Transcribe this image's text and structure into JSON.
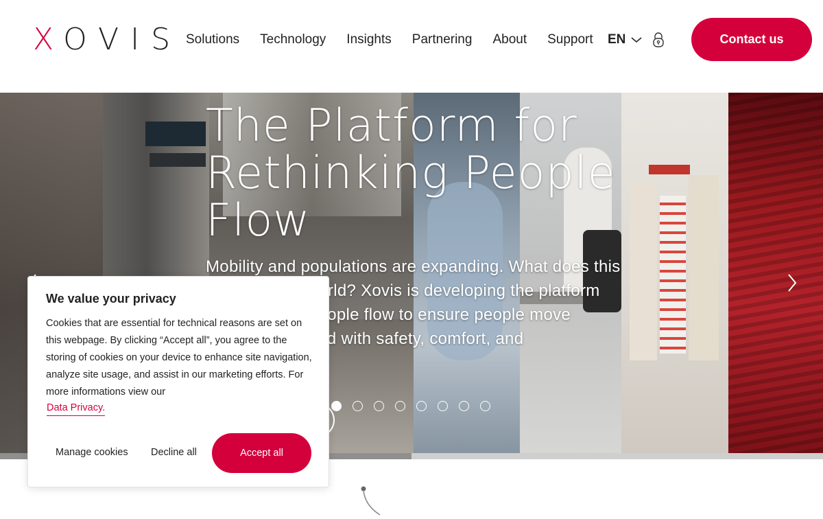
{
  "header": {
    "logo_x": "X",
    "logo_rest": "OVIS",
    "nav": [
      "Solutions",
      "Technology",
      "Insights",
      "Partnering",
      "About",
      "Support"
    ],
    "language": "EN",
    "contact_label": "Contact us"
  },
  "hero": {
    "title": "The Platform for Rethinking People Flow",
    "subtitle": "Mobility and populations are expanding. What does this mean for our world? Xovis is developing the platform for rethinking people flow to ensure people move through the world with safety, comfort, and",
    "slide_count": 8,
    "active_slide": 1,
    "progress_fraction": 0.5
  },
  "cookie": {
    "title": "We value your privacy",
    "text": "Cookies that are essential for technical reasons are set on this webpage. By clicking “Accept all”, you agree to the storing of cookies on your device to enhance site navigation, analyze site usage, and assist in our marketing efforts. For more informations view our",
    "link": "Data Privacy.",
    "manage": "Manage cookies",
    "decline": "Decline all",
    "accept": "Accept all"
  },
  "colors": {
    "brand": "#d4003c"
  },
  "icons": {
    "language": "chevron-down-icon",
    "login": "lock-icon",
    "next": "chevron-right-icon",
    "prev": "chevron-left-icon"
  }
}
